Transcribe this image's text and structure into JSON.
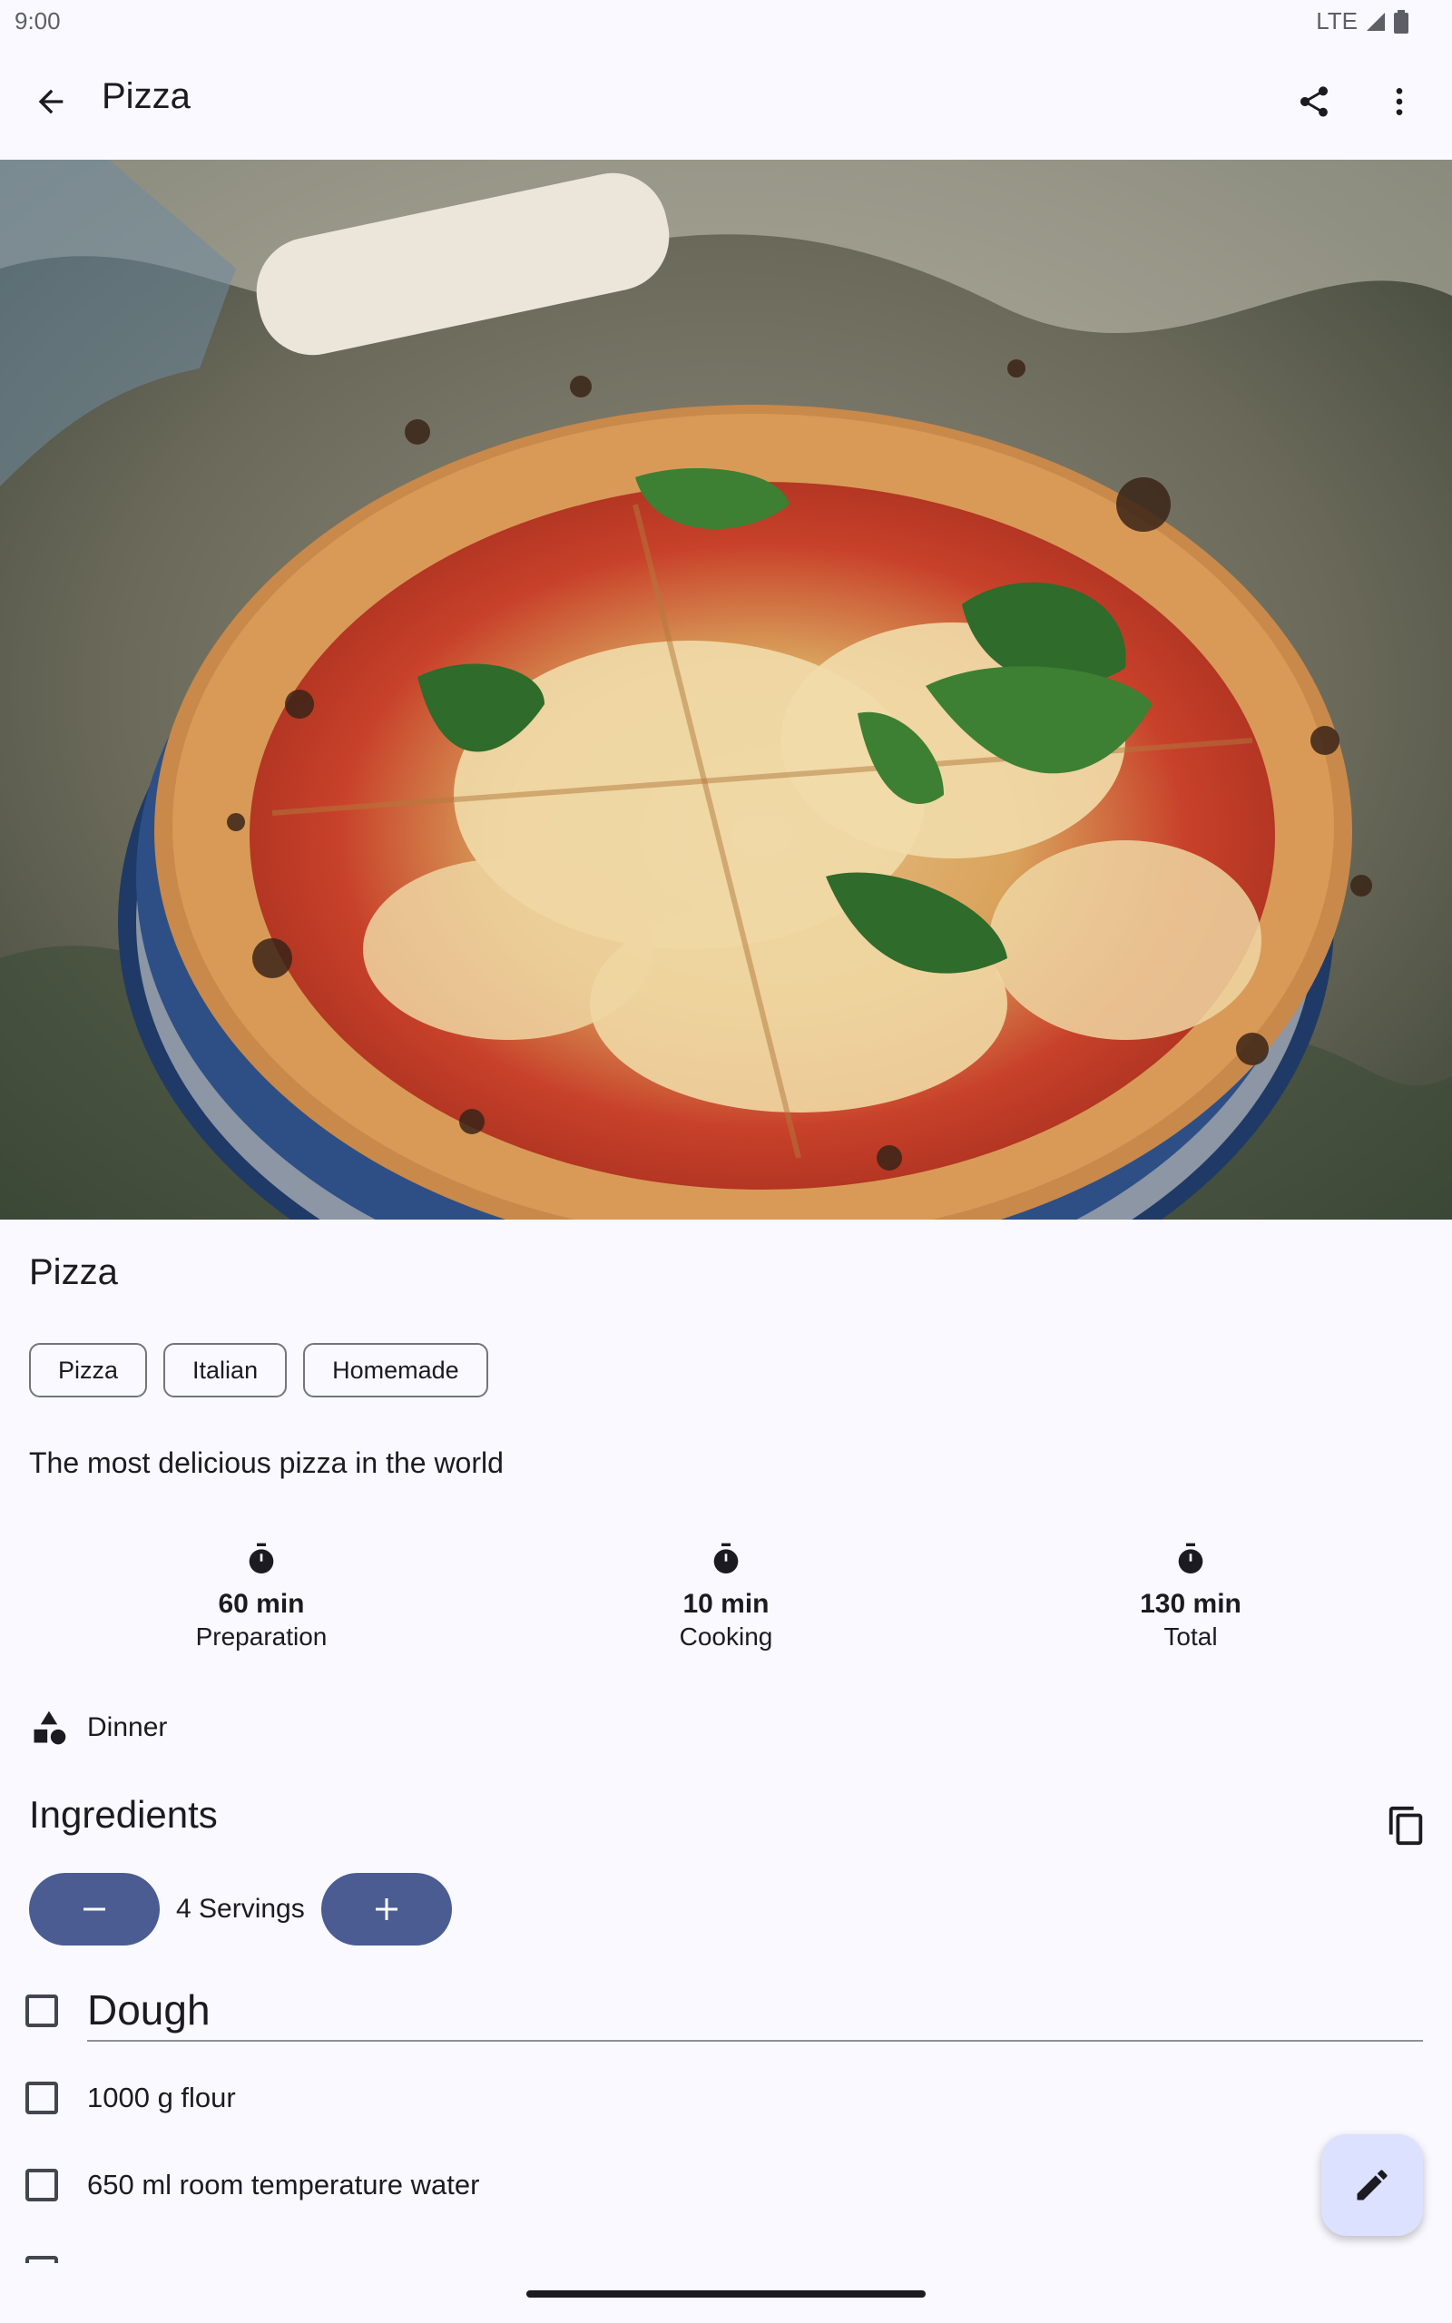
{
  "status_bar": {
    "time": "9:00",
    "network": "LTE"
  },
  "app_bar": {
    "title": "Pizza"
  },
  "recipe": {
    "title": "Pizza",
    "keywords": [
      "Pizza",
      "Italian",
      "Homemade"
    ],
    "description": "The most delicious pizza in the world",
    "times": [
      {
        "value": "60 min",
        "label": "Preparation"
      },
      {
        "value": "10 min",
        "label": "Cooking"
      },
      {
        "value": "130 min",
        "label": "Total"
      }
    ],
    "category": "Dinner"
  },
  "ingredients": {
    "heading": "Ingredients",
    "servings": "4 Servings",
    "section": "Dough",
    "items": [
      "1000 g flour",
      "650 ml room temperature water"
    ]
  },
  "colors": {
    "accent": "#4a5c92",
    "fab": "#dbe1ff",
    "background": "#f9f9ff"
  }
}
